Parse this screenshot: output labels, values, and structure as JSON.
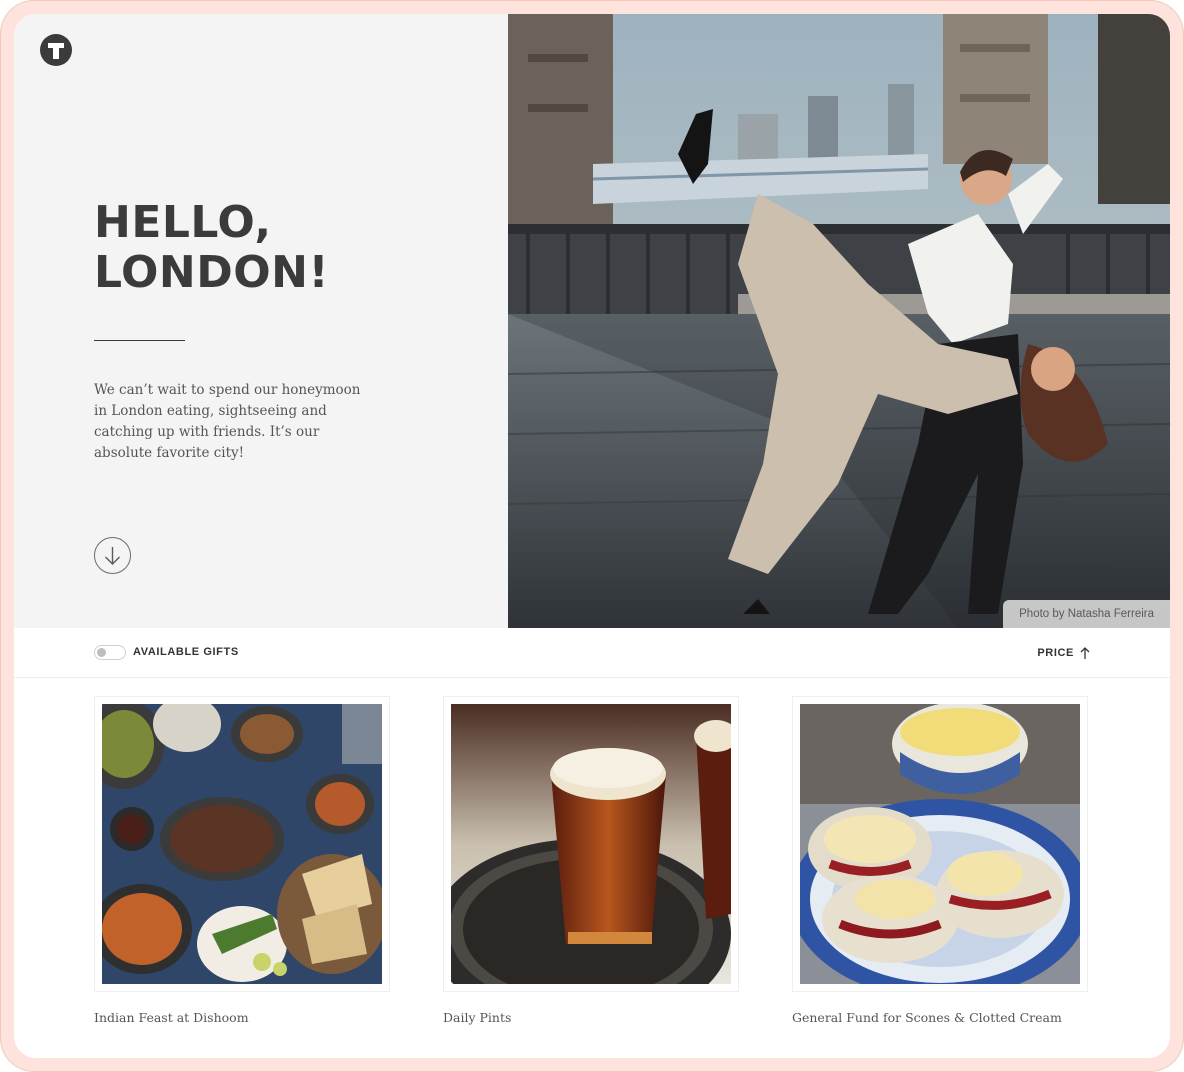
{
  "hero": {
    "title": "HELLO,\nLONDON!",
    "description": "We can’t wait to spend our honeymoon in London eating, sightseeing and catching up with friends. It’s our absolute favorite city!",
    "photo_credit": "Photo by Natasha Ferreira"
  },
  "filters": {
    "available_gifts_label": "AVAILABLE GIFTS",
    "available_gifts_on": false,
    "sort_label": "PRICE",
    "sort_direction": "ascending"
  },
  "gifts": [
    {
      "name": "Indian Feast at Dishoom",
      "image": "indian-feast-photo"
    },
    {
      "name": "Daily Pints",
      "image": "beer-pints-photo"
    },
    {
      "name": "General Fund for Scones & Clotted Cream",
      "image": "scones-photo"
    }
  ],
  "colors": {
    "frame": "#fde3dc",
    "hero_panel": "#f4f4f4",
    "heading": "#3b3b3b",
    "body_text": "#555555"
  }
}
